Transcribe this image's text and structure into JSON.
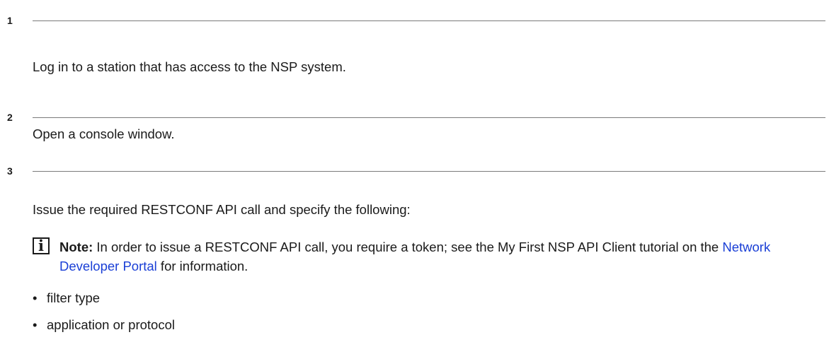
{
  "steps": [
    {
      "number": "1",
      "text": "Log in to a station that has access to the NSP system."
    },
    {
      "number": "2",
      "text": "Open a console window."
    },
    {
      "number": "3",
      "text": "Issue the required RESTCONF API call and specify the following:"
    }
  ],
  "note": {
    "icon": "info-icon",
    "label": "Note:",
    "text_before_link": " In order to issue a RESTCONF API call, you require a token; see the My First NSP API Client tutorial on the ",
    "link_text": "Network Developer Portal",
    "text_after_link": " for information.",
    "link_color": "#1a3fd6"
  },
  "bullets": [
    {
      "symbol": "•",
      "text": "filter type"
    },
    {
      "symbol": "•",
      "text": "application or protocol"
    }
  ]
}
